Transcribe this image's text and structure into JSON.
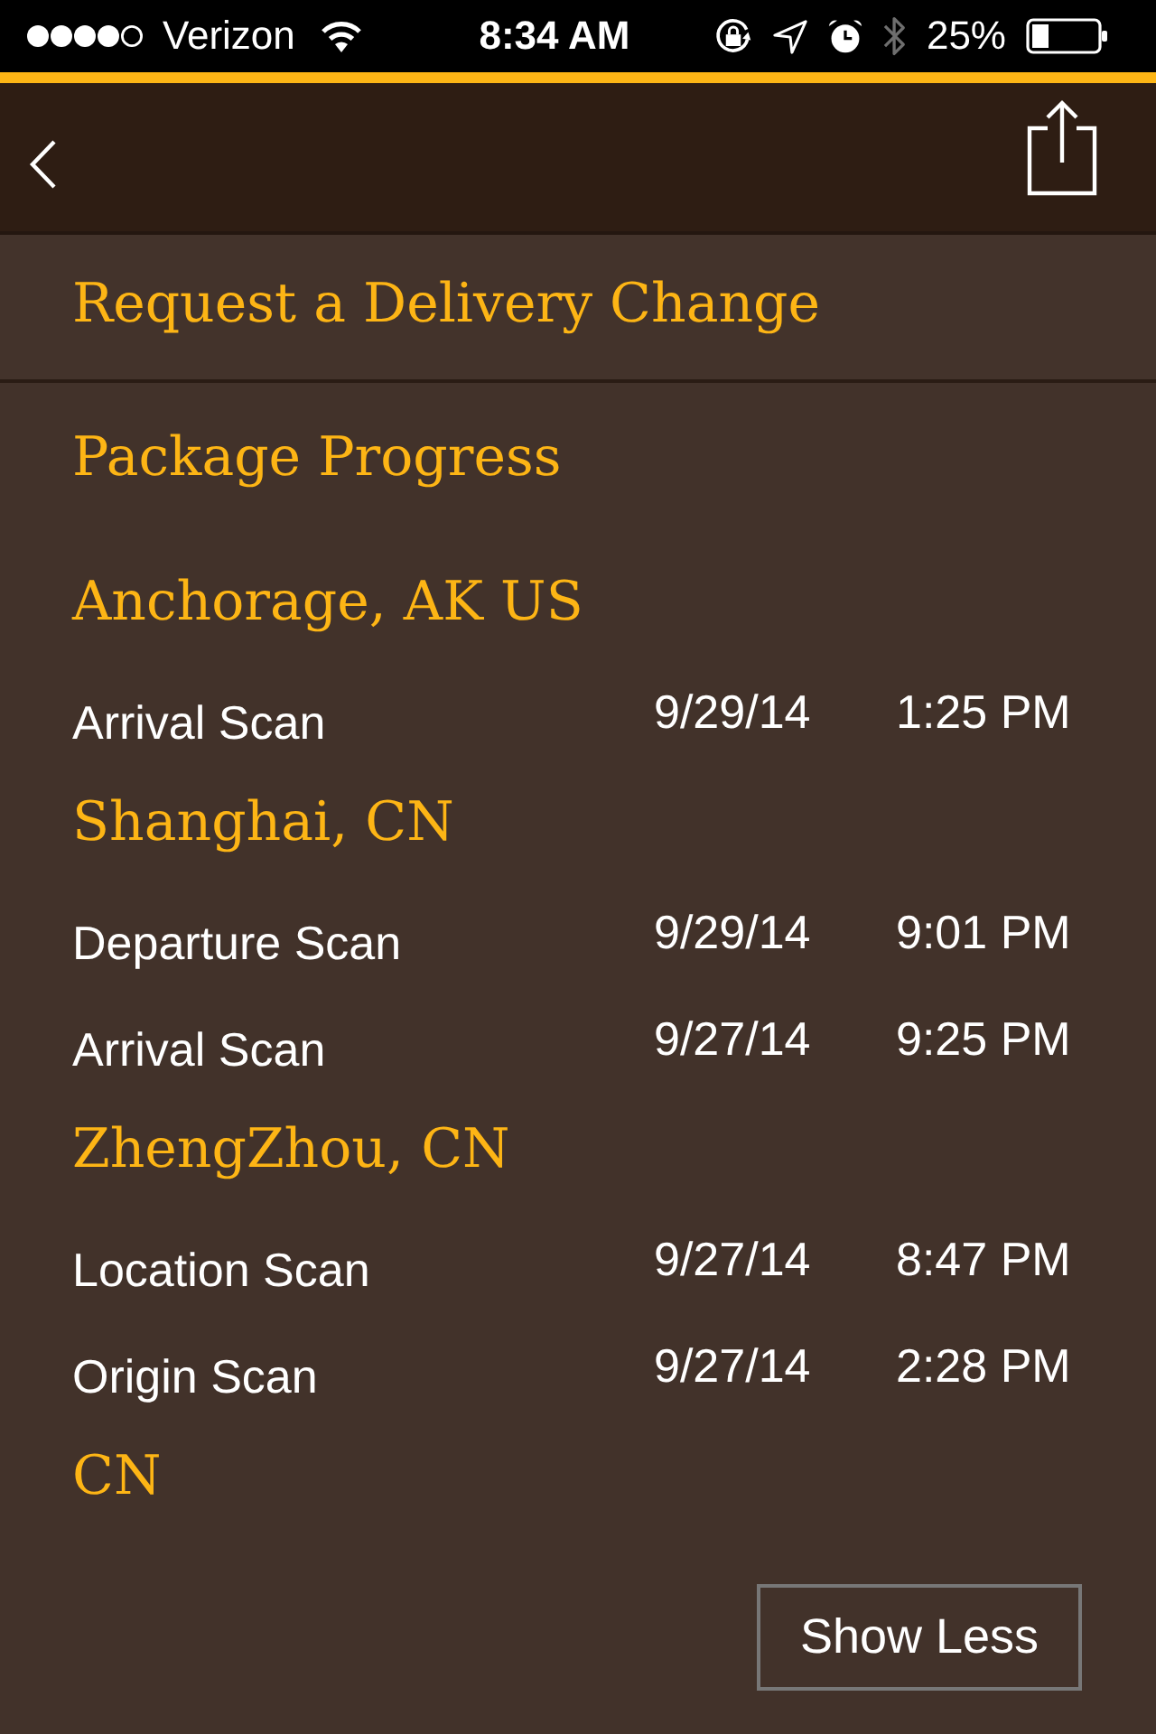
{
  "status_bar": {
    "carrier": "Verizon",
    "time": "8:34 AM",
    "bluetooth_on": false,
    "battery_percent": "25%"
  },
  "menu": [
    {
      "label": "Request a Delivery Change"
    }
  ],
  "package_progress": {
    "title": "Package Progress",
    "locations": [
      {
        "name": "Anchorage, AK US",
        "events": [
          {
            "activity": "Arrival Scan",
            "date": "9/29/14",
            "time": "1:25 PM"
          }
        ]
      },
      {
        "name": "Shanghai, CN",
        "events": [
          {
            "activity": "Departure Scan",
            "date": "9/29/14",
            "time": "9:01 PM"
          },
          {
            "activity": "Arrival Scan",
            "date": "9/27/14",
            "time": "9:25 PM"
          }
        ]
      },
      {
        "name": "ZhengZhou, CN",
        "events": [
          {
            "activity": "Location Scan",
            "date": "9/27/14",
            "time": "8:47 PM"
          },
          {
            "activity": "Origin Scan",
            "date": "9/27/14",
            "time": "2:28 PM"
          }
        ]
      },
      {
        "name": "CN"
      }
    ]
  },
  "show_less_button": {
    "label": "Show Less"
  }
}
